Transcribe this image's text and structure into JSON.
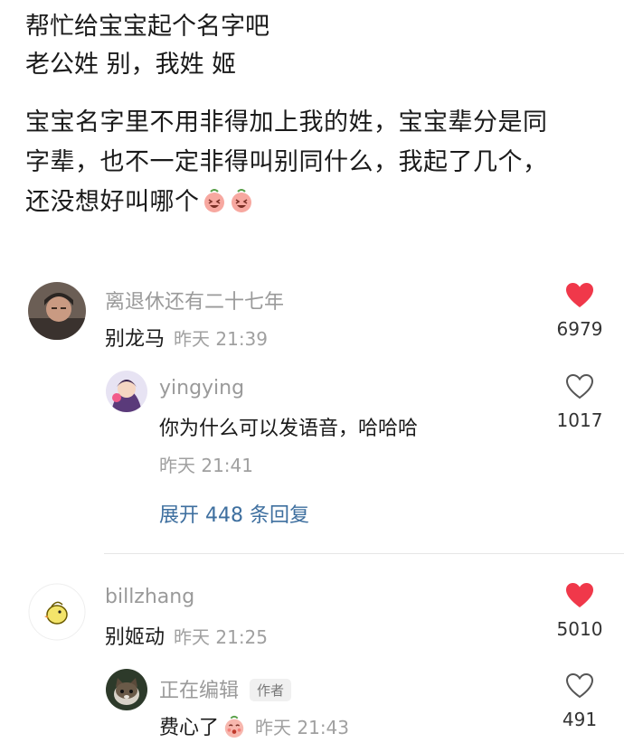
{
  "post": {
    "title": "帮忙给宝宝起个名字吧",
    "subtitle": "老公姓 别，我姓 姬",
    "body_line1": "宝宝名字里不用非得加上我的姓，宝宝辈分是同",
    "body_line2": "字辈，也不一定非得叫别同什么，我起了几个，",
    "body_line3": "还没想好叫哪个"
  },
  "comments": [
    {
      "user": "离退休还有二十七年",
      "text": "别龙马",
      "time": "昨天 21:39",
      "likes": "6979",
      "liked": true,
      "avatar_icon": "person-photo-icon"
    },
    {
      "user": "yingying",
      "text": "你为什么可以发语音，哈哈哈",
      "time": "昨天 21:41",
      "likes": "1017",
      "liked": false,
      "avatar_icon": "cartoon-girl-icon"
    },
    {
      "user": "billzhang",
      "text": "别姬动",
      "time": "昨天 21:25",
      "likes": "5010",
      "liked": true,
      "avatar_icon": "yellow-chick-icon"
    },
    {
      "user": "正在编辑",
      "badge": "作者",
      "text": "费心了",
      "time": "昨天 21:43",
      "likes": "491",
      "liked": false,
      "avatar_icon": "cat-photo-icon"
    }
  ],
  "expand_replies": "展开 448 条回复",
  "colors": {
    "heart_liked": "#f0384a",
    "heart_outline": "#555555",
    "expand_link": "#3e6f9f",
    "meta_gray": "#9a9a9a"
  }
}
